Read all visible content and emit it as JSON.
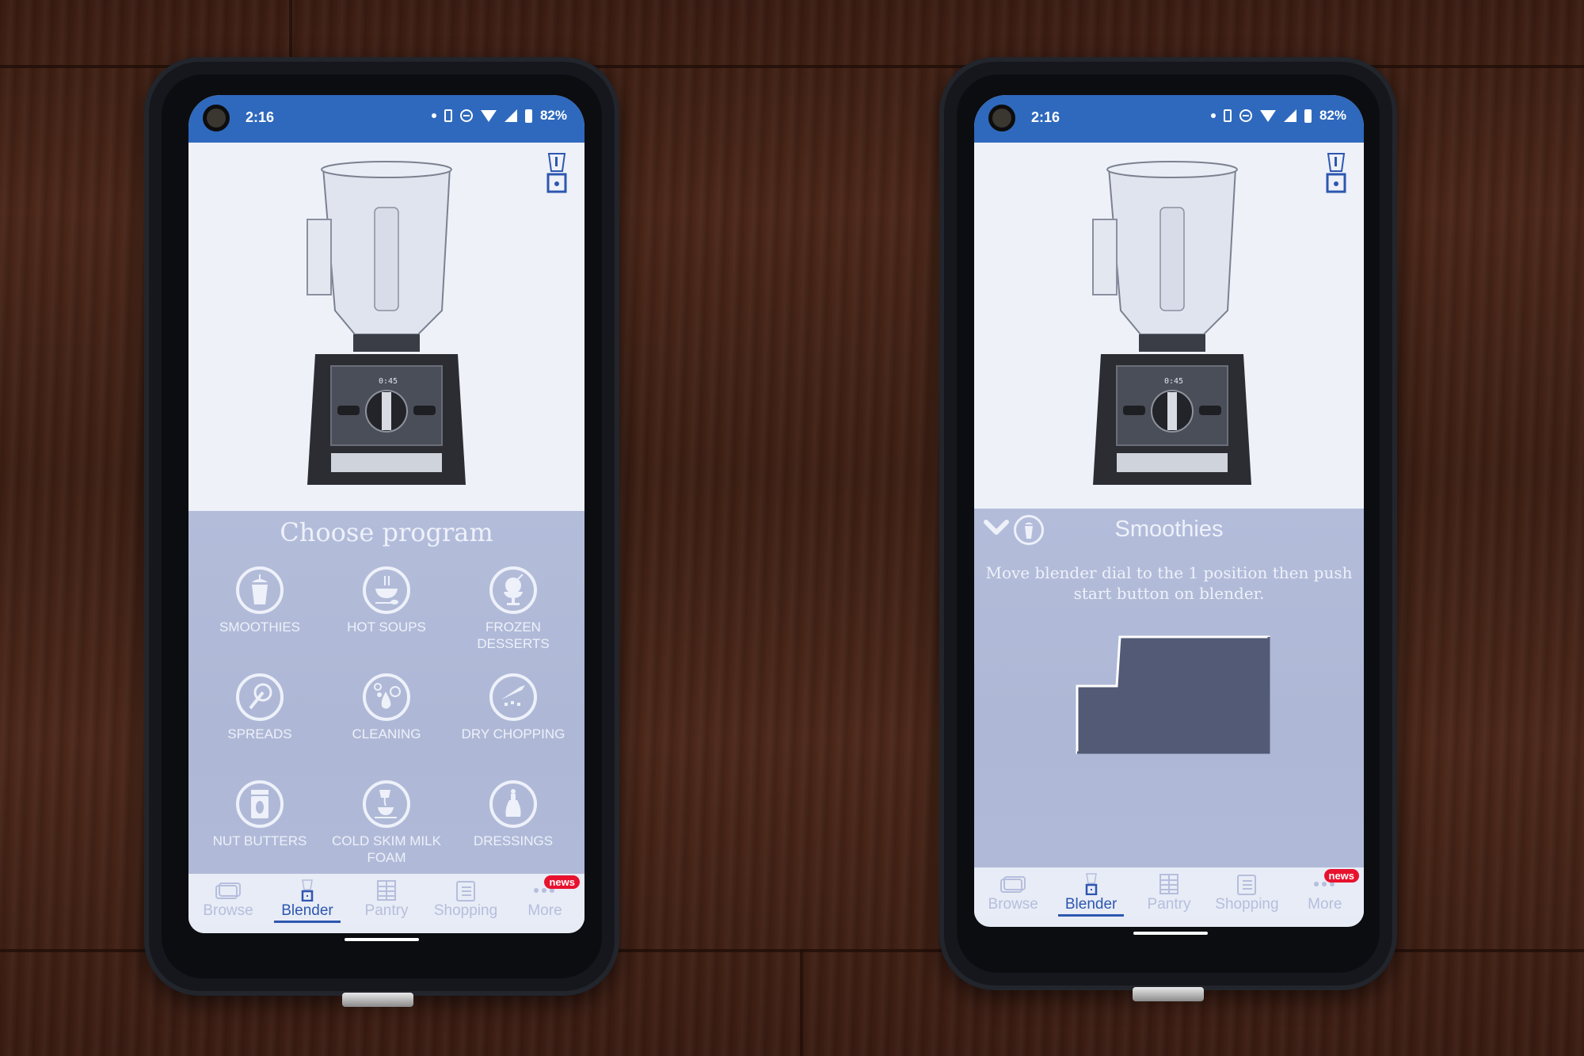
{
  "status_bar": {
    "time": "2:16",
    "battery": "82%",
    "icons": [
      "notification-dot-icon",
      "vibrate-icon",
      "do-not-disturb-icon",
      "wifi-icon",
      "signal-icon",
      "battery-icon"
    ],
    "color": "#2f69bd"
  },
  "left_phone": {
    "screen_title": "Choose program",
    "programs": [
      {
        "label": "SMOOTHIES",
        "icon": "smoothie-cup-icon"
      },
      {
        "label": "HOT SOUPS",
        "icon": "soup-bowl-icon"
      },
      {
        "label": "FROZEN DESSERTS",
        "icon": "ice-cream-icon"
      },
      {
        "label": "SPREADS",
        "icon": "spreading-knife-icon"
      },
      {
        "label": "CLEANING",
        "icon": "soap-bubbles-icon"
      },
      {
        "label": "DRY CHOPPING",
        "icon": "chopping-knife-icon"
      },
      {
        "label": "NUT BUTTERS",
        "icon": "nut-butter-jar-icon"
      },
      {
        "label": "COLD SKIM MILK FOAM",
        "icon": "milk-pour-cup-icon"
      },
      {
        "label": "DRESSINGS",
        "icon": "dressing-bottle-icon"
      }
    ]
  },
  "right_phone": {
    "program_title": "Smoothies",
    "instruction": "Move blender dial to the 1 position then push start button on blender."
  },
  "blender_display": "0:45",
  "tabs": [
    {
      "label": "Browse",
      "icon": "browse-folders-icon",
      "active": false
    },
    {
      "label": "Blender",
      "icon": "blender-icon",
      "active": true
    },
    {
      "label": "Pantry",
      "icon": "pantry-grid-icon",
      "active": false
    },
    {
      "label": "Shopping",
      "icon": "shopping-list-icon",
      "active": false
    },
    {
      "label": "More",
      "icon": "more-dots-icon",
      "active": false,
      "badge": "news"
    }
  ],
  "colors": {
    "accent": "#2d57b0",
    "panel": "#b0bad8",
    "badge": "#e8122e",
    "inactive_tab": "#b6bedd"
  }
}
